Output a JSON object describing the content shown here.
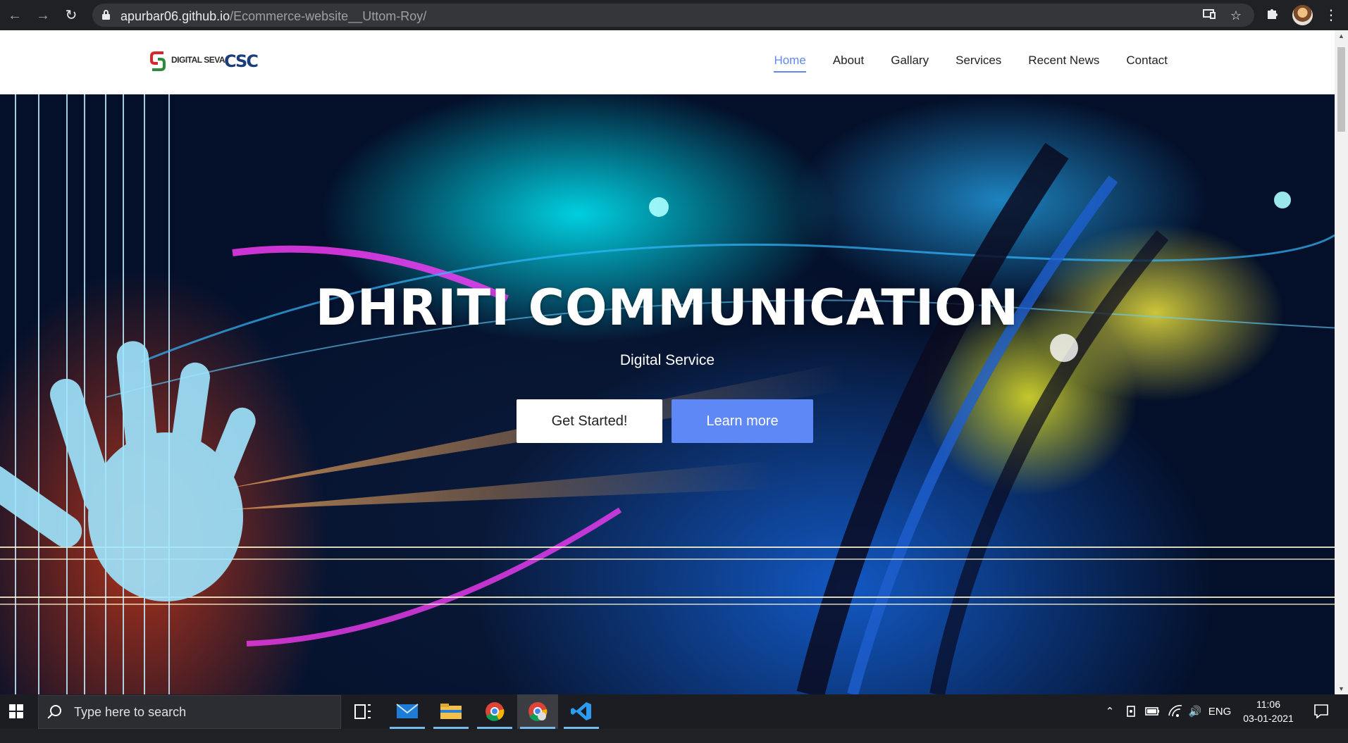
{
  "browser": {
    "url_host": "apurbar06.github.io",
    "url_path": "/Ecommerce-website__Uttom-Roy/"
  },
  "site": {
    "logo_text": "DIGITAL SEVA",
    "logo_csc": "CSC",
    "nav": [
      "Home",
      "About",
      "Gallary",
      "Services",
      "Recent News",
      "Contact"
    ],
    "active_nav": "Home",
    "accent_color": "#5e88f5"
  },
  "hero": {
    "title": "DHRITI COMMUNICATION",
    "subtitle": "Digital Service",
    "primary_button": "Get Started!",
    "secondary_button": "Learn more"
  },
  "taskbar": {
    "search_placeholder": "Type here to search",
    "language": "ENG",
    "time": "11:06",
    "date": "03-01-2021"
  }
}
